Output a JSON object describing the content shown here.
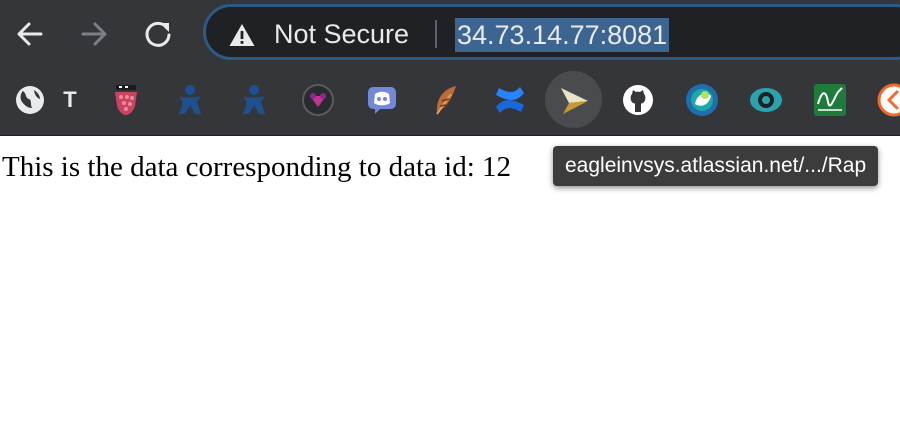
{
  "omnibox": {
    "security_label": "Not Secure",
    "url": "34.73.14.77:8081"
  },
  "bookmarks": {
    "items": [
      {
        "icon": "globe-icon"
      },
      {
        "text": "T"
      },
      {
        "icon": "raspberry-icon"
      },
      {
        "icon": "jira-icon"
      },
      {
        "icon": "jira-icon"
      },
      {
        "icon": "heart-badge-icon"
      },
      {
        "icon": "discord-icon"
      },
      {
        "icon": "feather-icon"
      },
      {
        "icon": "confluence-icon"
      },
      {
        "icon": "play-arrow-icon"
      },
      {
        "icon": "github-icon"
      },
      {
        "icon": "circle-app-icon"
      },
      {
        "icon": "eye-icon"
      },
      {
        "icon": "chart-icon"
      },
      {
        "icon": "back-circle-icon"
      }
    ]
  },
  "page": {
    "text": "This is the data corresponding to data id: 12"
  },
  "tooltip": {
    "text": "eagleinvsys.atlassian.net/.../Rap"
  },
  "colors": {
    "toolbar": "#35363a",
    "omnibox": "#202124",
    "url_selection": "#3d6591",
    "omnibox_border": "#2c5a86"
  }
}
